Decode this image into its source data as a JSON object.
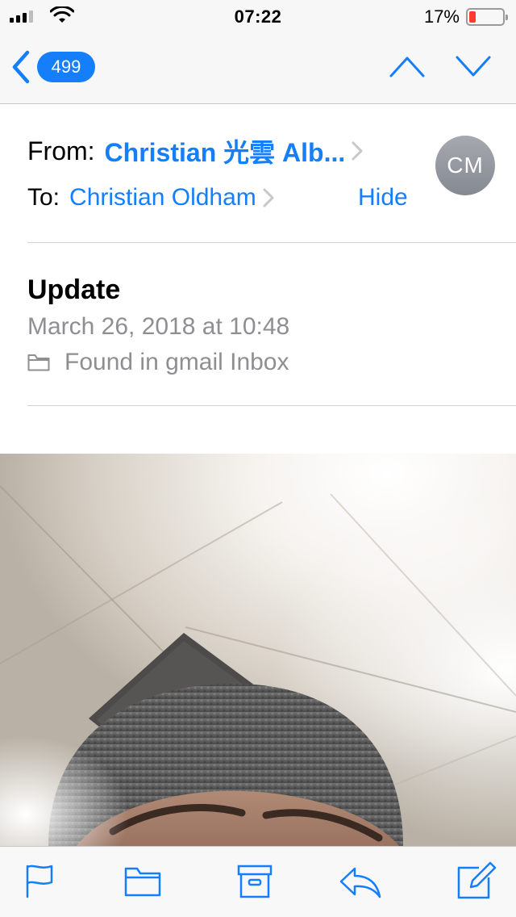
{
  "status_bar": {
    "time": "07:22",
    "battery_percent": "17%",
    "signal_bars_filled": 3,
    "signal_bars_total": 4,
    "battery_level": 0.17
  },
  "nav": {
    "back_count": "499",
    "icons": [
      "chevron-left-icon",
      "chevron-up-icon",
      "chevron-down-icon"
    ]
  },
  "message": {
    "from_label": "From:",
    "from_name": "Christian 光雲 Alb...",
    "to_label": "To:",
    "to_name": "Christian Oldham",
    "hide_label": "Hide",
    "avatar_initials": "CM",
    "subject": "Update",
    "date": "March 26, 2018 at 10:48",
    "folder_text": "Found in gmail Inbox"
  },
  "toolbar": {
    "items": [
      "flag-icon",
      "folder-icon",
      "archive-icon",
      "reply-icon",
      "compose-icon"
    ]
  },
  "colors": {
    "accent": "#147efb",
    "secondary_text": "#8e8e93",
    "battery_low": "#ff3b30"
  }
}
